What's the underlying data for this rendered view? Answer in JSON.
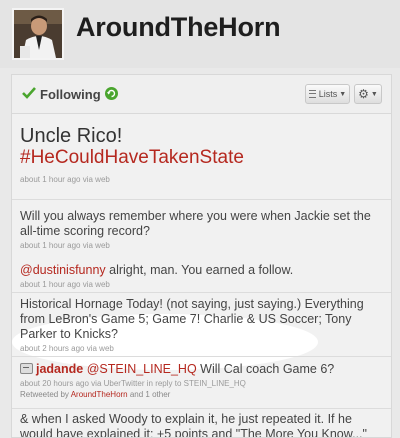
{
  "profile": {
    "username": "AroundTheHorn"
  },
  "following_bar": {
    "label": "Following",
    "lists_label": "Lists"
  },
  "tweets": [
    {
      "line1": "Uncle Rico!",
      "line2": "#HeCouldHaveTakenState",
      "meta": "about 1 hour ago via web"
    },
    {
      "text": "Will you always remember where you were when Jackie set the all-time scoring record?",
      "meta": "about 1 hour ago via web"
    },
    {
      "mention": "@dustinisfunny",
      "text": " alright, man. You earned a follow.",
      "meta": "about 1 hour ago via web"
    },
    {
      "text": "Historical Hornage Today! (not saying, just saying.) Everything from LeBron's Game 5; Game 7! Charlie & US Soccer; Tony Parker to Knicks?",
      "meta": "about 2 hours ago via web"
    },
    {
      "author": "jadande",
      "mention": "@STEIN_LINE_HQ",
      "text": " Will Cal coach Game 6?",
      "meta": "about 20 hours ago via UberTwitter in reply to STEIN_LINE_HQ",
      "retweet_prefix": "Retweeted by ",
      "retweet_user": "AroundTheHorn",
      "retweet_suffix": " and 1 other"
    },
    {
      "text": "& when I asked Woody to explain it, he just repeated it. If he would have explained it: +5 points and \"The More You Know...\" PSA"
    }
  ],
  "colors": {
    "accent_red": "#b5281f",
    "check_green": "#4aa52e"
  }
}
